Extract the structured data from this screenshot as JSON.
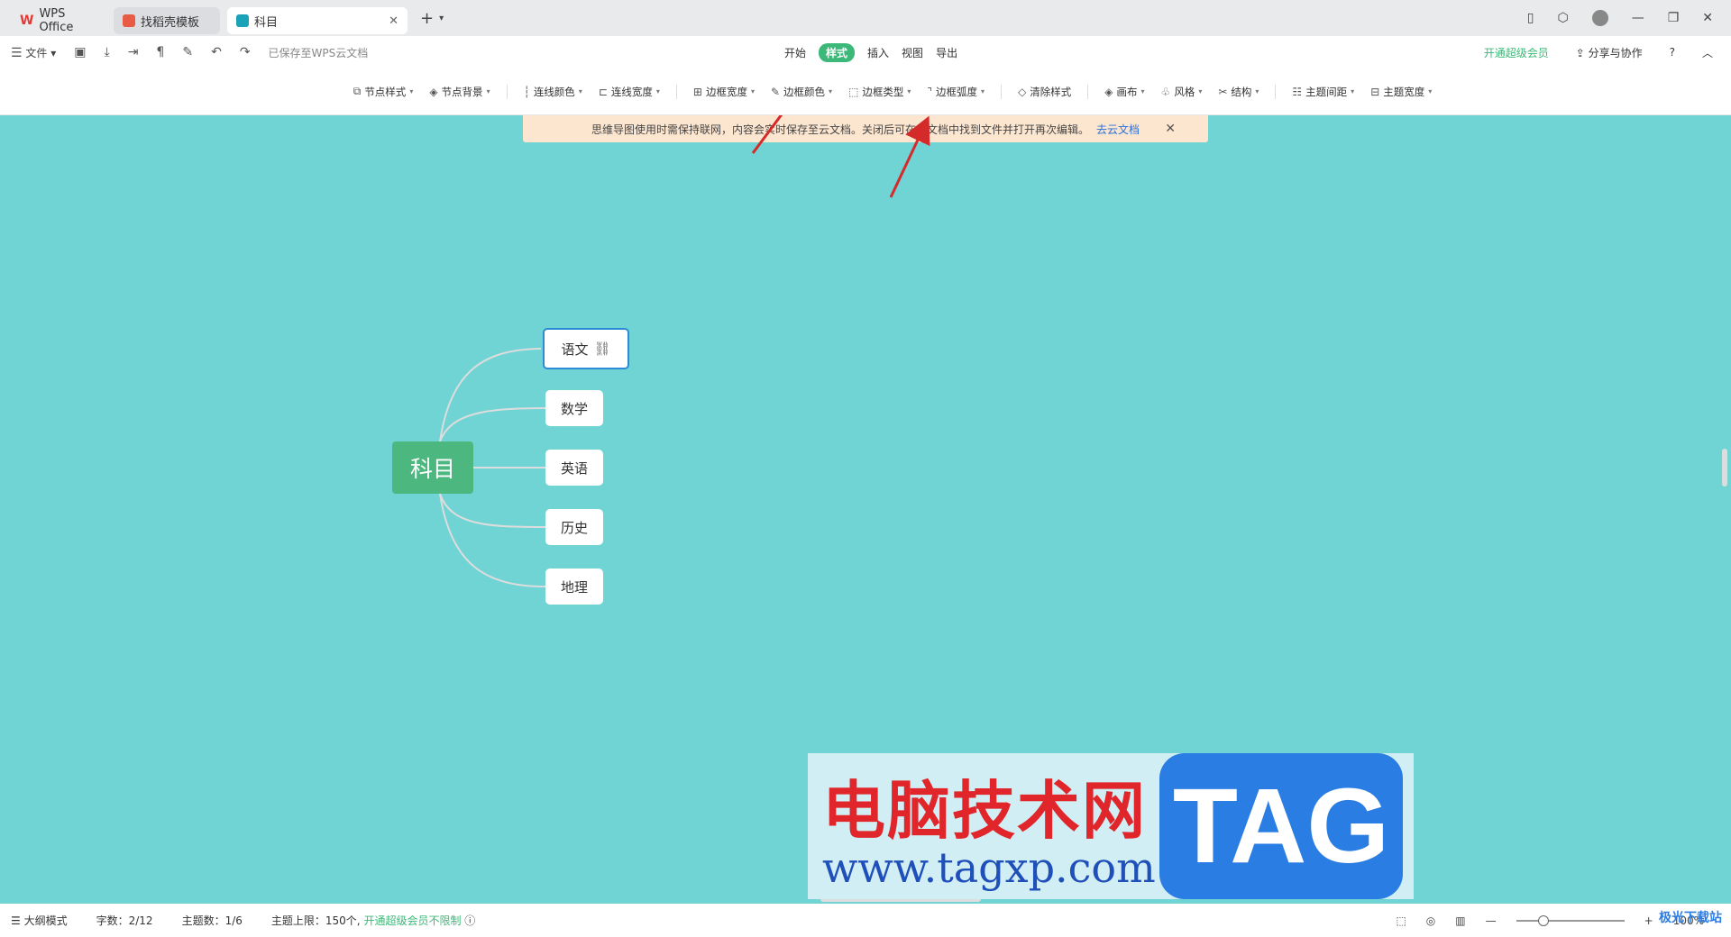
{
  "tabs": [
    {
      "label": "WPS Office"
    },
    {
      "label": "找稻壳模板"
    },
    {
      "label": "科目"
    }
  ],
  "menubar": {
    "file": "文件",
    "saved_status": "已保存至WPS云文档",
    "tabs": [
      "开始",
      "样式",
      "插入",
      "视图",
      "导出"
    ],
    "active_tab": "样式",
    "vip": "开通超级会员",
    "share": "分享与协作"
  },
  "toolbar": {
    "items": [
      "节点样式",
      "节点背景",
      "连线颜色",
      "连线宽度",
      "边框宽度",
      "边框颜色",
      "边框类型",
      "边框弧度",
      "清除样式",
      "画布",
      "风格",
      "结构",
      "主题间距",
      "主题宽度"
    ]
  },
  "notice": {
    "text": "思维导图使用时需保持联网，内容会实时保存至云文档。关闭后可在云文档中找到文件并打开再次编辑。",
    "link": "去云文档"
  },
  "mindmap": {
    "root": "科目",
    "children": [
      "语文",
      "数学",
      "英语",
      "历史",
      "地理"
    ]
  },
  "watermark": {
    "title": "电脑技术网",
    "url": "www.tagxp.com",
    "tag": "TAG"
  },
  "statusbar": {
    "outline_mode": "大纲模式",
    "word_count": "字数：2/12",
    "topic_count": "主题数：1/6",
    "topic_limit": "主题上限：150个,",
    "vip_unlimited": "开通超级会员不限制",
    "zoom": "100%"
  },
  "corner_logo": "极光下载站"
}
